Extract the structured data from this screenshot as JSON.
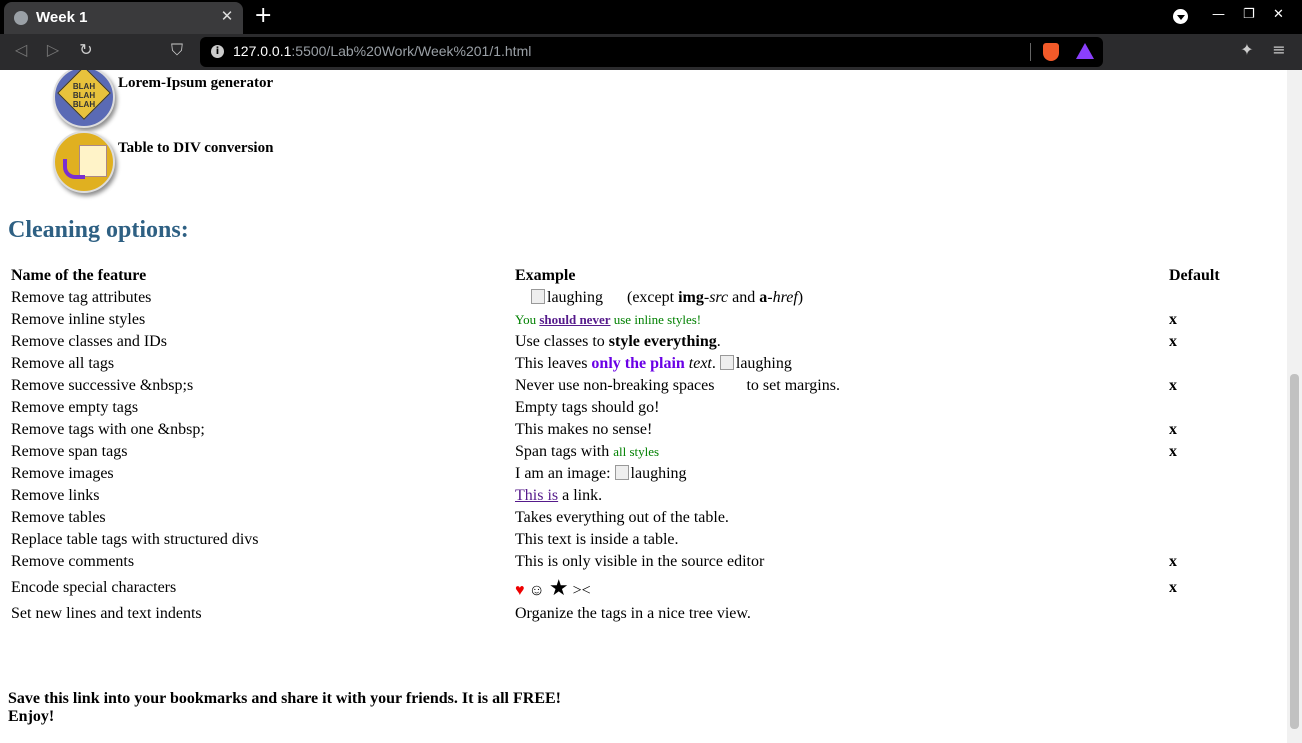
{
  "browser": {
    "tab_title": "Week 1",
    "tab_close": "✕",
    "new_tab": "+",
    "url_host": "127.0.0.1",
    "url_rest": ":5500/Lab%20Work/Week%201/1.html",
    "minimize": "—",
    "restore": "❐",
    "close": "✕",
    "menu": "≡"
  },
  "features": [
    {
      "label": "Lorem-Ipsum generator",
      "icon_text": "BLAH BLAH BLAH"
    },
    {
      "label": "Table to DIV conversion"
    }
  ],
  "section_title": "Cleaning options:",
  "table": {
    "headers": [
      "Name of the feature",
      "Example",
      "Default"
    ],
    "rows": [
      {
        "name": "Remove tag attributes",
        "default": ""
      },
      {
        "name": "Remove inline styles",
        "default": "x"
      },
      {
        "name": "Remove classes and IDs",
        "default": "x"
      },
      {
        "name": "Remove all tags",
        "default": ""
      },
      {
        "name": "Remove successive &nbsp;s",
        "default": "x"
      },
      {
        "name": "Remove empty tags",
        "default": ""
      },
      {
        "name": "Remove tags with one &nbsp;",
        "default": "x"
      },
      {
        "name": "Remove span tags",
        "default": "x"
      },
      {
        "name": "Remove images",
        "default": ""
      },
      {
        "name": "Remove links",
        "default": ""
      },
      {
        "name": "Remove tables",
        "default": ""
      },
      {
        "name": "Replace table tags with structured divs",
        "default": ""
      },
      {
        "name": "Remove comments",
        "default": "x"
      },
      {
        "name": "Encode special characters",
        "default": "x"
      },
      {
        "name": "Set new lines and text indents",
        "default": ""
      }
    ],
    "examples": {
      "r0_img": "laughing",
      "r0_a": "(except ",
      "r0_b": "img",
      "r0_c": "-src",
      "r0_d": " and ",
      "r0_e": "a",
      "r0_f": "-href",
      "r0_g": ")",
      "r1_a": "You ",
      "r1_b": "should never",
      "r1_c": " use inline styles!",
      "r2_a": "Use classes to ",
      "r2_b": "style everything",
      "r2_c": ".",
      "r3_a": "This leaves ",
      "r3_b": "only the plain",
      "r3_c": " ",
      "r3_d": "text",
      "r3_e": ". ",
      "r3_img": "laughing",
      "r4_a": "Never use non-breaking spaces",
      "r4_b": "to set margins.",
      "r5": "Empty tags should go!",
      "r6": "This makes no sense!",
      "r7_a": "Span tags with ",
      "r7_b": "all styles",
      "r8_a": "I am an image: ",
      "r8_img": "laughing",
      "r9_a": "This is",
      "r9_b": " a link.",
      "r10": "Takes everything out of the table.",
      "r11": "This text is inside a table.",
      "r12": "This is only visible in the source editor",
      "r13_heart": "♥",
      "r13_smile": "☺",
      "r13_star": "★",
      "r13_rest": "><",
      "r14": "Organize the tags in a nice tree view."
    }
  },
  "footer": {
    "line1": "Save this link into your bookmarks and share it with your friends. It is all FREE!",
    "line2": "Enjoy!"
  }
}
